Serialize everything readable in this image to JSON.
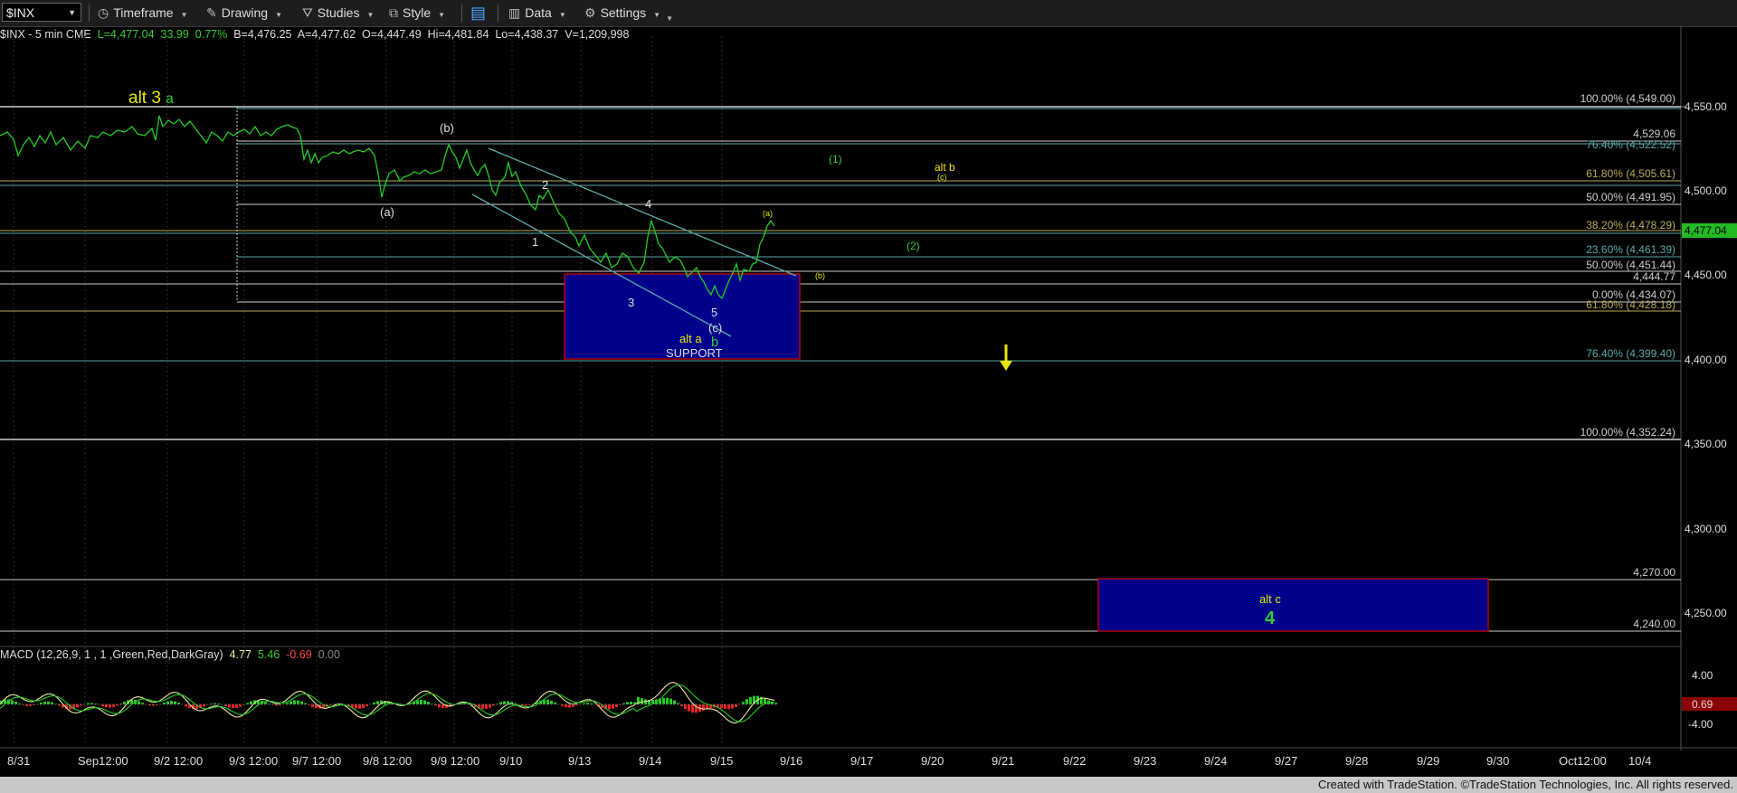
{
  "toolbar": {
    "symbol": "$INX",
    "timeframe": "Timeframe",
    "drawing": "Drawing",
    "studies": "Studies",
    "style": "Style",
    "data": "Data",
    "settings": "Settings"
  },
  "info_bar": {
    "name": "$INX - 5 min  CME",
    "last": "L=4,477.04",
    "change": "33.99",
    "pct": "0.77%",
    "bid": "B=4,476.25",
    "ask": "A=4,477.62",
    "open": "O=4,447.49",
    "high": "Hi=4,481.84",
    "low": "Lo=4,438.37",
    "volume": "V=1,209,998"
  },
  "price_axis": {
    "ticks": [
      "4,550.00",
      "4,500.00",
      "4,450.00",
      "4,400.00",
      "4,350.00",
      "4,300.00",
      "4,250.00"
    ],
    "current_label": "4,477.04",
    "macd_ticks": [
      "4.00",
      "-4.00"
    ],
    "macd_current": "0.69"
  },
  "time_axis": [
    "8/31",
    "Sep12:00",
    "9/2 12:00",
    "9/3 12:00",
    "9/7 12:00",
    "9/8 12:00",
    "9/9 12:00",
    "9/10",
    "9/13",
    "9/14",
    "9/15",
    "9/16",
    "9/17",
    "9/20",
    "9/21",
    "9/22",
    "9/23",
    "9/24",
    "9/27",
    "9/28",
    "9/29",
    "9/30",
    "Oct12:00",
    "10/4"
  ],
  "fib_levels": [
    {
      "text": "100.00% (4,549.00)"
    },
    {
      "text": "4,529.06"
    },
    {
      "text": "76.40% (4,522.52)"
    },
    {
      "text": "61.80% (4,505.61)"
    },
    {
      "text": "50.00% (4,491.95)"
    },
    {
      "text": "38.20% (4,478.29)"
    },
    {
      "text": "23.60% (4,461.39)"
    },
    {
      "text": "50.00% (4,451.44)"
    },
    {
      "text": "4,444.77"
    },
    {
      "text": "0.00% (4,434.07)"
    },
    {
      "text": "61.80% (4,428.18)"
    },
    {
      "text": "76.40% (4,399.40)"
    },
    {
      "text": "100.00% (4,352.24)"
    },
    {
      "text": "4,270.00"
    },
    {
      "text": "4,240.00"
    }
  ],
  "annotations": {
    "alt3": "alt 3",
    "alt3_a": "a",
    "wave_b_paren": "(b)",
    "wave_a_paren": "(a)",
    "w1": "1",
    "w2": "2",
    "w3": "3",
    "w4": "4",
    "w5": "5",
    "wc_paren": "(c)",
    "alt_a": "alt a",
    "b": "b",
    "support": "SUPPORT",
    "a_small": "(a)",
    "b_small": "(b)",
    "one_paren": "(1)",
    "two_paren": "(2)",
    "alt_b": "alt b",
    "c_small": "(c)",
    "alt_c": "alt c",
    "four": "4"
  },
  "macd": {
    "title": "MACD (12,26,9, 1 , 1 ,Green,Red,DarkGray)",
    "v1": "4.77",
    "v2": "5.46",
    "v3": "-0.69",
    "v4": "0.00"
  },
  "footer": "Created with TradeStation. ©TradeStation Technologies, Inc. All rights reserved.",
  "colors": {
    "price": "#22cc22",
    "yellow": "#e8e800",
    "green": "#33cc33",
    "box": "#00008b",
    "box_border": "#c00000",
    "teal": "#5aa9a9"
  }
}
